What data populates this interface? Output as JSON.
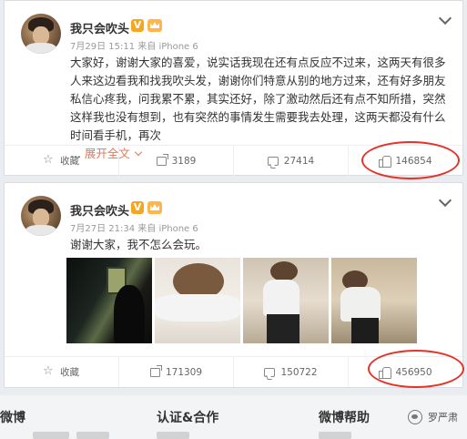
{
  "posts": [
    {
      "username": "我只会吹头",
      "verified_badge": "V",
      "meta": "7月29日 15:11 来自 iPhone 6",
      "text": "大家好，谢谢大家的喜爱，说实话我现在还有点反应不过来，这两天有很多人来这边看我和找我吹头发，谢谢你们特意从别的地方过来，还有好多朋友私信心疼我，问我累不累，其实还好，除了激动然后还有点不知所措，突然这样我也没有想到，也有突然的事情发生需要我去处理，这两天都没有什么时间看手机，再次",
      "ellipsis": "...",
      "expand_label": "展开全文",
      "actions": {
        "favorite": "收藏",
        "share": "3189",
        "comment": "27414",
        "like": "146854"
      }
    },
    {
      "username": "我只会吹头",
      "verified_badge": "V",
      "meta": "7月27日 21:34 来自 iPhone 6",
      "text": "谢谢大家，我不怎么会玩。",
      "actions": {
        "favorite": "收藏",
        "share": "171309",
        "comment": "150722",
        "like": "456950"
      }
    }
  ],
  "footer": {
    "col1": "微博",
    "col2": "认证&合作",
    "col3": "微博帮助",
    "watermark": "罗严肃"
  },
  "colors": {
    "accent": "#eb7350",
    "highlight_ring": "#e3332a",
    "badge": "#f5a623"
  }
}
